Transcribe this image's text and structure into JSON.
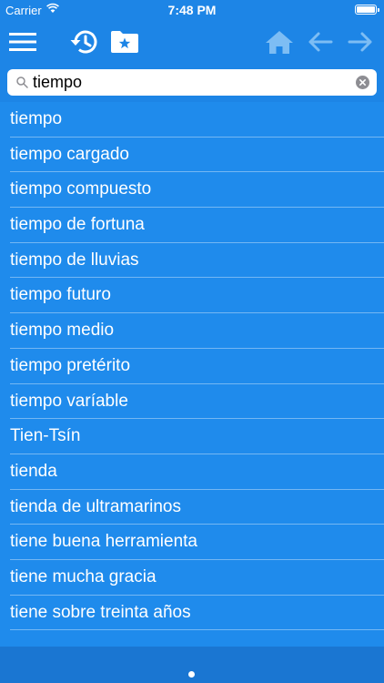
{
  "status_bar": {
    "carrier": "Carrier",
    "time": "7:48 PM",
    "battery_level": 1.0
  },
  "toolbar": {
    "icons": [
      "menu-icon",
      "history-icon",
      "favorites-folder-icon",
      "home-icon",
      "back-arrow-icon",
      "forward-arrow-icon"
    ],
    "icon_color": "#ffffff",
    "disabled_icon_color": "#7dbdf4"
  },
  "search": {
    "value": "tiempo",
    "placeholder": ""
  },
  "results": [
    {
      "label": "tiempo"
    },
    {
      "label": "tiempo cargado"
    },
    {
      "label": "tiempo compuesto"
    },
    {
      "label": "tiempo de fortuna"
    },
    {
      "label": "tiempo de lluvias"
    },
    {
      "label": "tiempo futuro"
    },
    {
      "label": "tiempo medio"
    },
    {
      "label": "tiempo pretérito"
    },
    {
      "label": "tiempo varíable"
    },
    {
      "label": "Tien-Tsín"
    },
    {
      "label": "tienda"
    },
    {
      "label": "tienda de ultramarinos"
    },
    {
      "label": "tiene buena herramienta"
    },
    {
      "label": "tiene mucha gracia"
    },
    {
      "label": "tiene sobre treinta años"
    }
  ],
  "colors": {
    "primary": "#1d85e6",
    "list_background": "#1f8bec",
    "bottom_bar": "#1a76d2"
  },
  "pager": {
    "pages": 1,
    "current": 1
  }
}
